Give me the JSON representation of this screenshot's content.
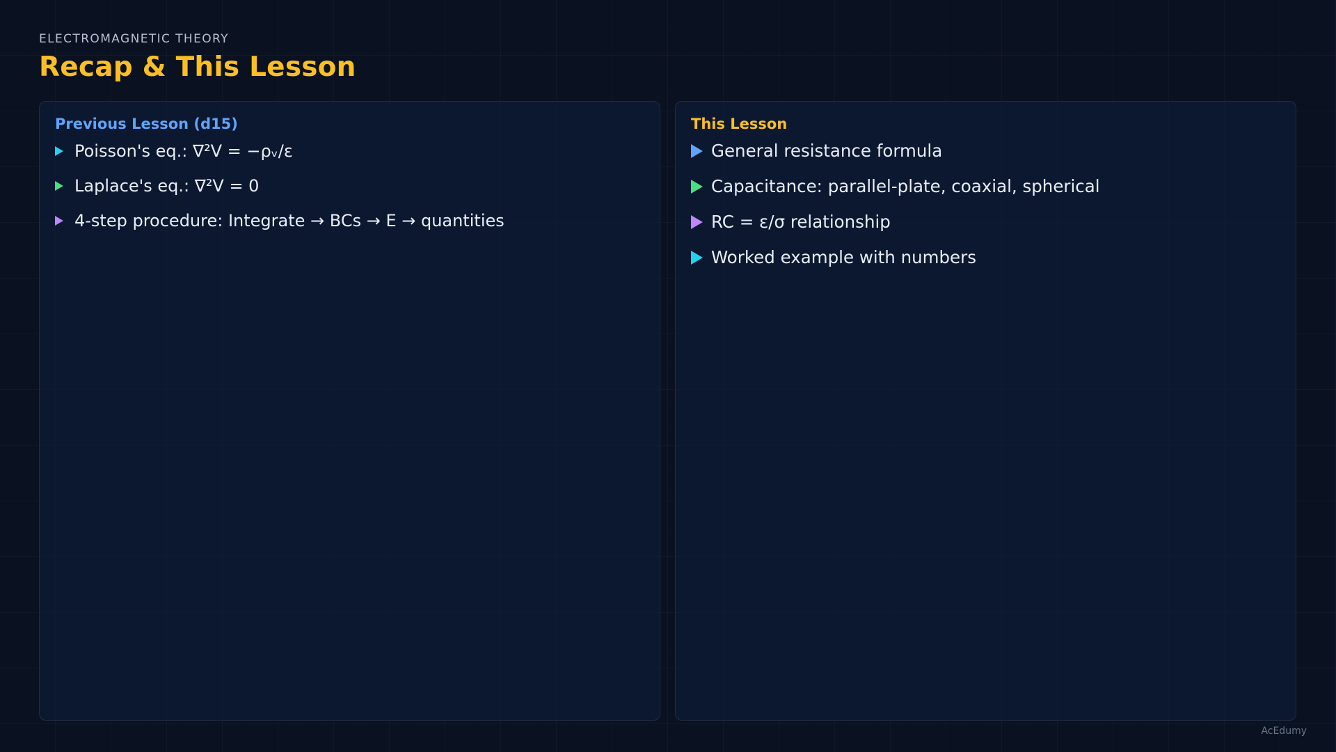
{
  "header": {
    "kicker": "ELECTROMAGNETIC THEORY",
    "title": "Recap & This Lesson"
  },
  "previous": {
    "heading": "Previous Lesson (d15)",
    "items": [
      {
        "text": "Poisson's eq.: ∇²V = −ρᵥ/ε",
        "bullet_color": "#22d3ee"
      },
      {
        "text": "Laplace's eq.: ∇²V = 0",
        "bullet_color": "#4ade80"
      },
      {
        "text": "4-step procedure: Integrate → BCs → E → quantities",
        "bullet_color": "#c084fc"
      }
    ]
  },
  "current": {
    "heading": "This Lesson",
    "items": [
      {
        "text": "General resistance formula",
        "bullet_color": "#60a5fa"
      },
      {
        "text": "Capacitance: parallel-plate, coaxial, spherical",
        "bullet_color": "#4ade80"
      },
      {
        "text": "RC = ε/σ relationship",
        "bullet_color": "#c084fc"
      },
      {
        "text": "Worked example with numbers",
        "bullet_color": "#22d3ee"
      }
    ]
  },
  "footer": {
    "brand": "AcEdumy"
  },
  "colors": {
    "accent": "#fbbf24",
    "previous_heading": "#60a5fa",
    "background": "#0a1120"
  }
}
